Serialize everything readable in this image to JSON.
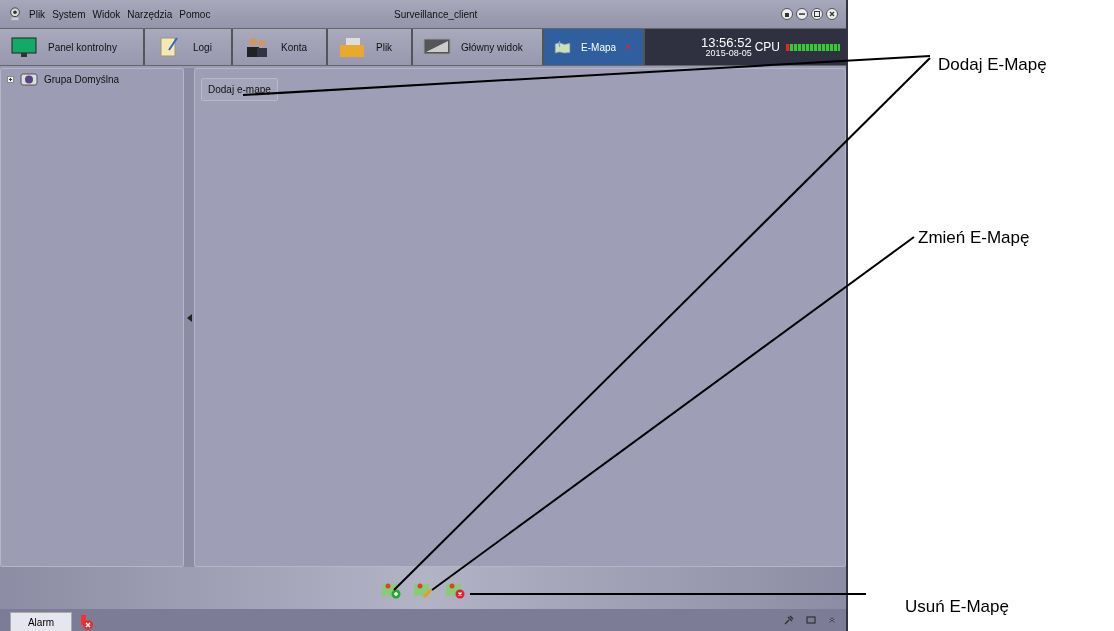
{
  "window": {
    "title": "Surveillance_client"
  },
  "menu": [
    "Plik",
    "System",
    "Widok",
    "Narzędzia",
    "Pomoc"
  ],
  "tabs": [
    {
      "label": "Panel kontrolny",
      "selected": false,
      "kind": "monitor"
    },
    {
      "label": "Logi",
      "selected": false,
      "kind": "notes"
    },
    {
      "label": "Konta",
      "selected": false,
      "kind": "users"
    },
    {
      "label": "Plik",
      "selected": false,
      "kind": "folder"
    },
    {
      "label": "Główny widok",
      "selected": false,
      "kind": "screen"
    },
    {
      "label": "E-Mapa",
      "selected": true,
      "kind": "map"
    }
  ],
  "clock": {
    "time": "13:56:52",
    "date": "2015-08-05"
  },
  "cpu": {
    "label": "CPU",
    "level": 1
  },
  "tree": [
    {
      "label": "Grupa Domyślna",
      "expanded": false
    }
  ],
  "add_map_button": "Dodaj e-mapę",
  "status_bar": {
    "alarm_tab": "Alarm"
  },
  "annotations": [
    {
      "label": "Dodaj E-Mapę"
    },
    {
      "label": "Zmień E-Mapę"
    },
    {
      "label": "Usuń E-Mapę"
    }
  ]
}
